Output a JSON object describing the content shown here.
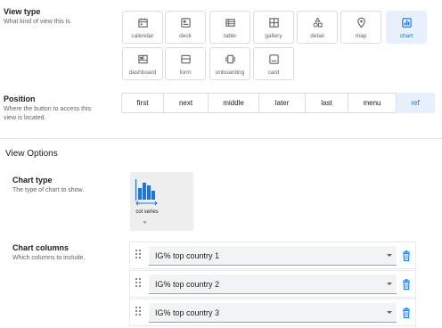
{
  "view_type": {
    "title": "View type",
    "description": "What kind of view this is.",
    "options": [
      {
        "label": "calendar",
        "icon": "calendar-icon"
      },
      {
        "label": "deck",
        "icon": "deck-icon"
      },
      {
        "label": "table",
        "icon": "table-icon"
      },
      {
        "label": "gallery",
        "icon": "gallery-icon"
      },
      {
        "label": "detail",
        "icon": "detail-icon"
      },
      {
        "label": "map",
        "icon": "map-pin-icon"
      },
      {
        "label": "chart",
        "icon": "bar-chart-icon"
      },
      {
        "label": "dashboard",
        "icon": "dashboard-icon"
      },
      {
        "label": "form",
        "icon": "form-icon"
      },
      {
        "label": "onboarding",
        "icon": "onboarding-icon"
      },
      {
        "label": "card",
        "icon": "card-icon"
      }
    ],
    "selected": "chart"
  },
  "position": {
    "title": "Position",
    "description_line1": "Where the button to access this",
    "description_line2": "view is located.",
    "options": [
      "first",
      "next",
      "middle",
      "later",
      "last",
      "menu",
      "ref"
    ],
    "selected": "ref"
  },
  "view_options": {
    "title": "View Options"
  },
  "chart_type": {
    "title": "Chart type",
    "description": "The type of chart to show.",
    "selected_label": "col series",
    "icon": "column-series-chart-icon"
  },
  "chart_columns": {
    "title": "Chart columns",
    "description": "Which columns to include.",
    "columns": [
      "IG% top country 1",
      "IG% top country 2",
      "IG% top country 3"
    ]
  },
  "colors": {
    "accent": "#1a73e8",
    "selected_bg": "#e8f0fe",
    "border": "#dadce0"
  }
}
